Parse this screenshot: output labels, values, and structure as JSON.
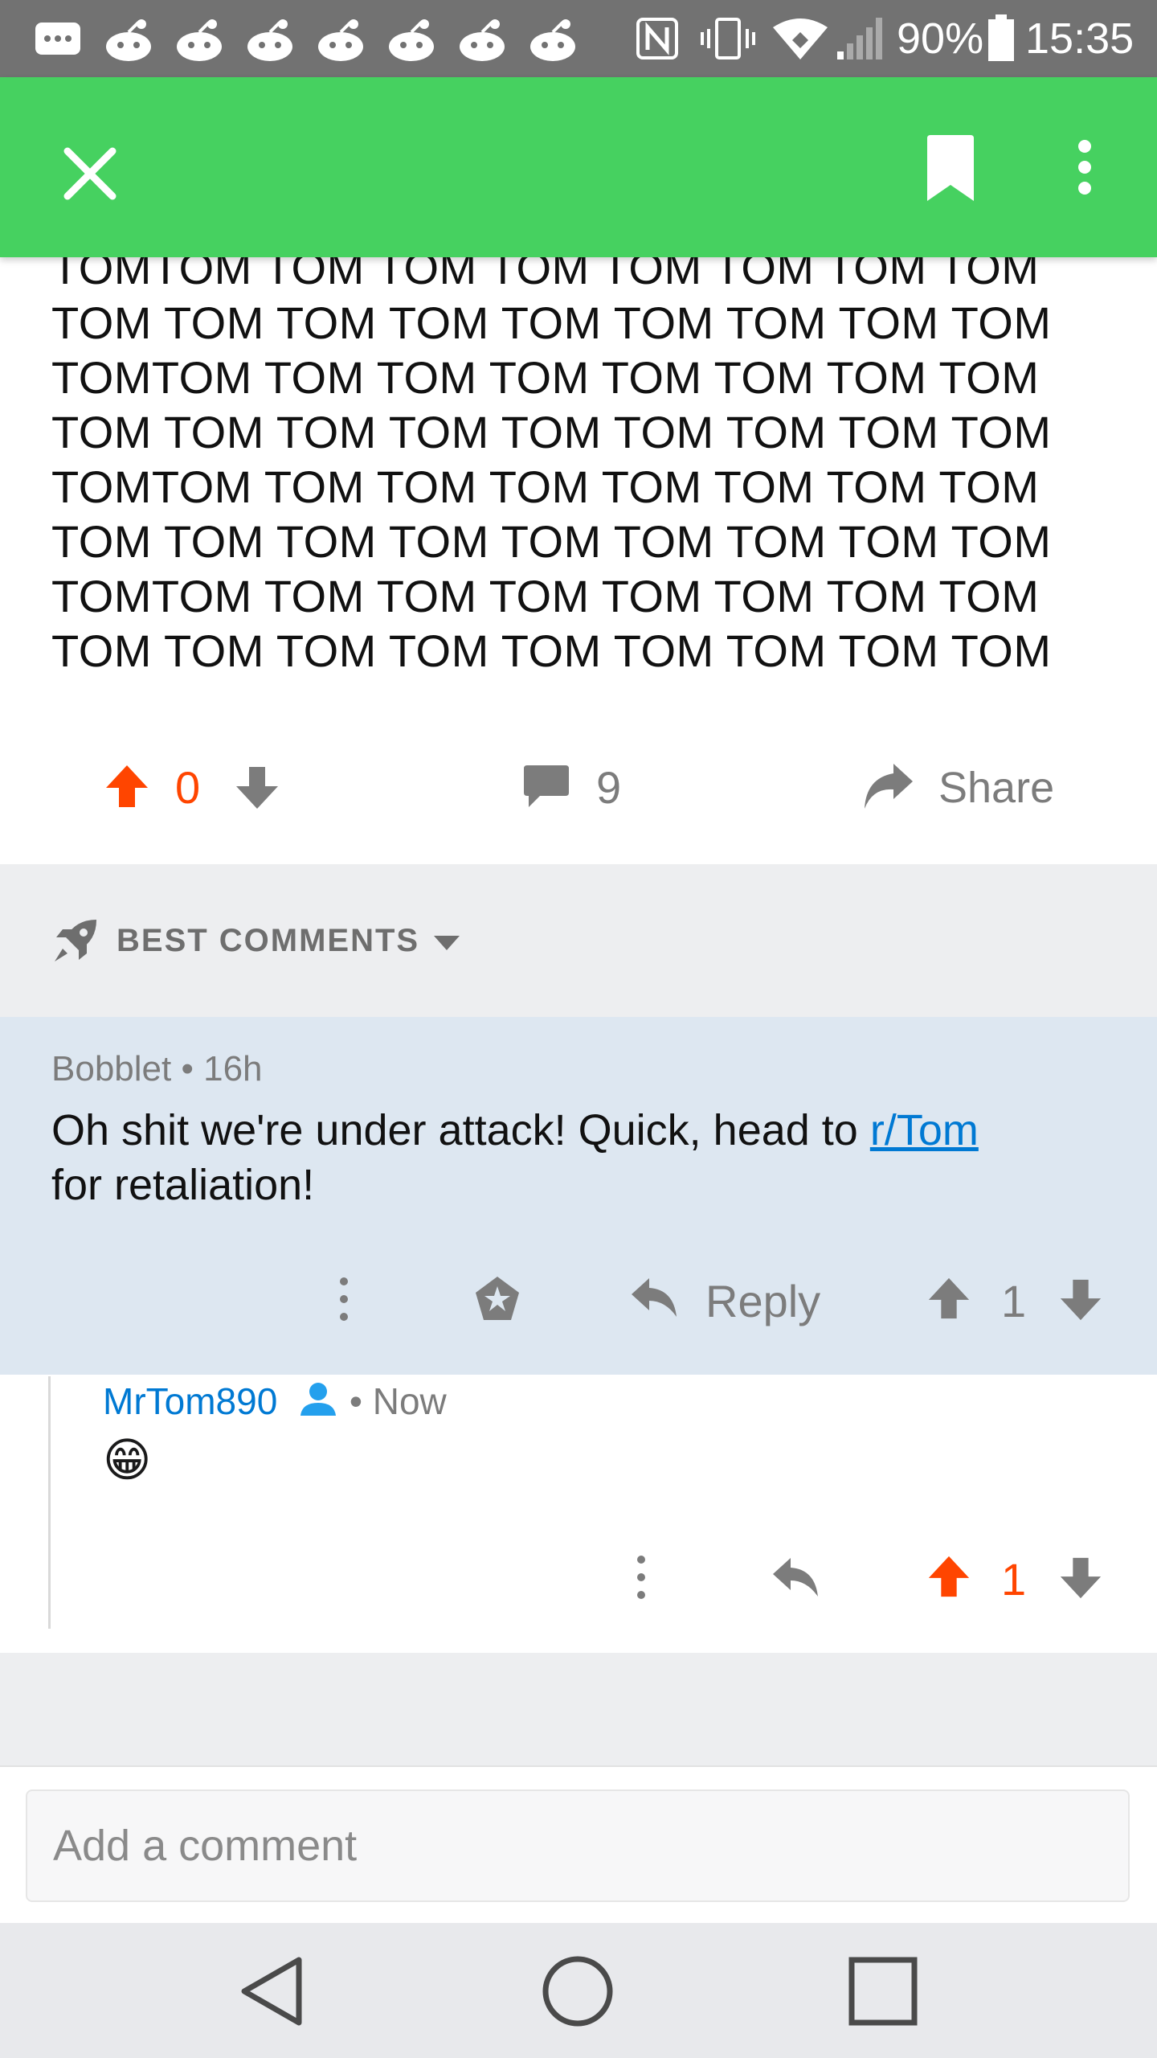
{
  "status_bar": {
    "battery_percent": "90%",
    "time": "15:35",
    "notification_icons": [
      "message-icon",
      "reddit-icon",
      "reddit-icon",
      "reddit-icon",
      "reddit-icon",
      "reddit-icon",
      "reddit-icon",
      "reddit-icon"
    ],
    "system_icons": [
      "nfc-icon",
      "vibrate-icon",
      "wifi-icon",
      "signal-icon",
      "battery-icon"
    ]
  },
  "app_bar": {
    "close_icon": "close-icon",
    "bookmark_icon": "bookmark-icon",
    "more_icon": "more-vert-icon",
    "color": "#46d160"
  },
  "post": {
    "body": "TOMTOM TOM TOM TOM TOM TOM TOM TOM\nTOM TOM TOM TOM TOM TOM TOM TOM TOM\nTOMTOM TOM TOM TOM TOM TOM TOM TOM\nTOM TOM TOM TOM TOM TOM TOM TOM TOM\nTOMTOM TOM TOM TOM TOM TOM TOM TOM\nTOM TOM TOM TOM TOM TOM TOM TOM TOM\nTOMTOM TOM TOM TOM TOM TOM TOM TOM\nTOM TOM TOM TOM TOM TOM TOM TOM TOM",
    "score": "0",
    "comment_count": "9",
    "share_label": "Share"
  },
  "sort": {
    "label": "BEST COMMENTS"
  },
  "comments": [
    {
      "author": "Bobblet",
      "age": "16h",
      "text_before_link": "Oh shit we're under attack! Quick, head to ",
      "link_text": "r/Tom",
      "text_after_link": "for retaliation!",
      "reply_label": "Reply",
      "score": "1"
    },
    {
      "author": "MrTom890",
      "age": "Now",
      "emoji": "😁",
      "score": "1"
    }
  ],
  "compose": {
    "placeholder": "Add a comment"
  },
  "colors": {
    "upvote": "#ff4500",
    "link": "#0079d3",
    "highlight_comment_bg": "#dde7f1"
  }
}
